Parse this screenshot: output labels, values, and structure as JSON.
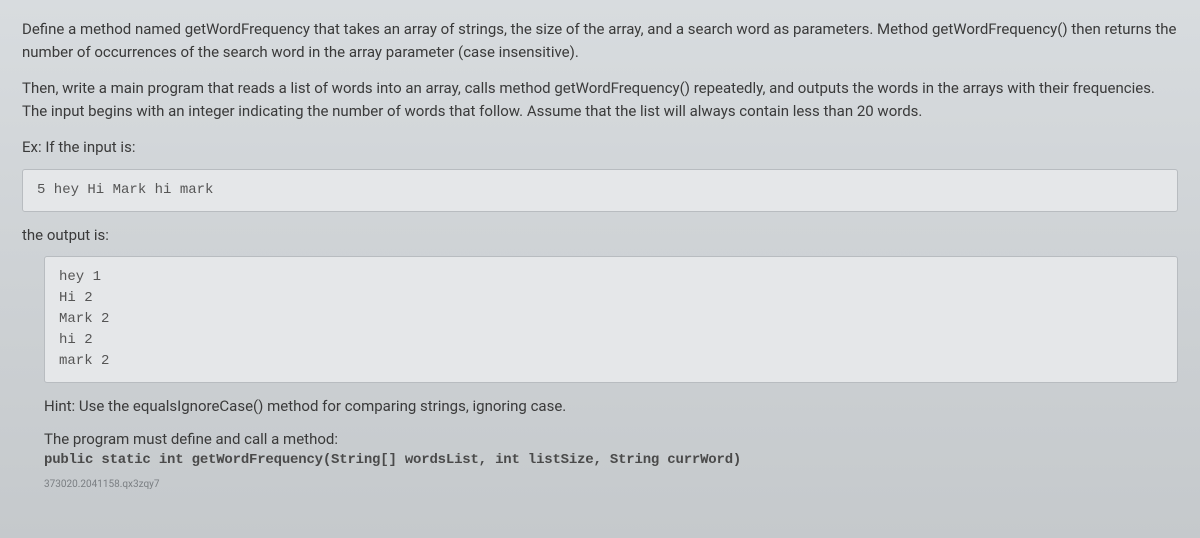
{
  "paragraph1": "Define a method named getWordFrequency that takes an array of strings, the size of the array, and a search word as parameters. Method getWordFrequency() then returns the number of occurrences of the search word in the array parameter (case insensitive).",
  "paragraph2": "Then, write a main program that reads a list of words into an array, calls method getWordFrequency() repeatedly, and outputs the words in the arrays with their frequencies. The input begins with an integer indicating the number of words that follow. Assume that the list will always contain less than 20 words.",
  "ex_label": "Ex: If the input is:",
  "input_code": "5 hey Hi Mark hi mark",
  "output_label": "the output is:",
  "output_code": "hey 1\nHi 2\nMark 2\nhi 2\nmark 2",
  "hint": "Hint: Use the equalsIgnoreCase() method for comparing strings, ignoring case.",
  "method_intro": "The program must define and call a method:",
  "method_sig": "public static int getWordFrequency(String[] wordsList, int listSize, String currWord)",
  "small_id": "373020.2041158.qx3zqy7"
}
